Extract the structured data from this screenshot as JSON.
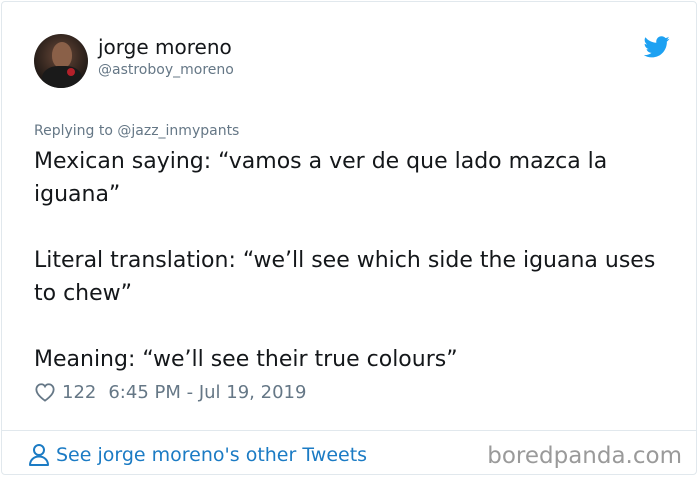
{
  "author": {
    "display_name": "jorge moreno",
    "handle": "@astroboy_moreno",
    "avatar_icon": "profile-photo"
  },
  "reply_to": "Replying to @jazz_inmypants",
  "tweet": {
    "text": "Mexican saying: “vamos a ver de que lado mazca la iguana”\n\nLiteral translation: “we’ll see which side the iguana uses to chew”\n\nMeaning: “we’ll see their true colours”"
  },
  "meta": {
    "likes": "122",
    "timestamp": "6:45 PM - Jul 19, 2019"
  },
  "footer": {
    "link_label": "See jorge moreno's other Tweets"
  },
  "watermark": "boredpanda.com",
  "colors": {
    "twitter_blue": "#1da1f2",
    "link_blue": "#1b7bc4",
    "muted_gray": "#657786"
  }
}
